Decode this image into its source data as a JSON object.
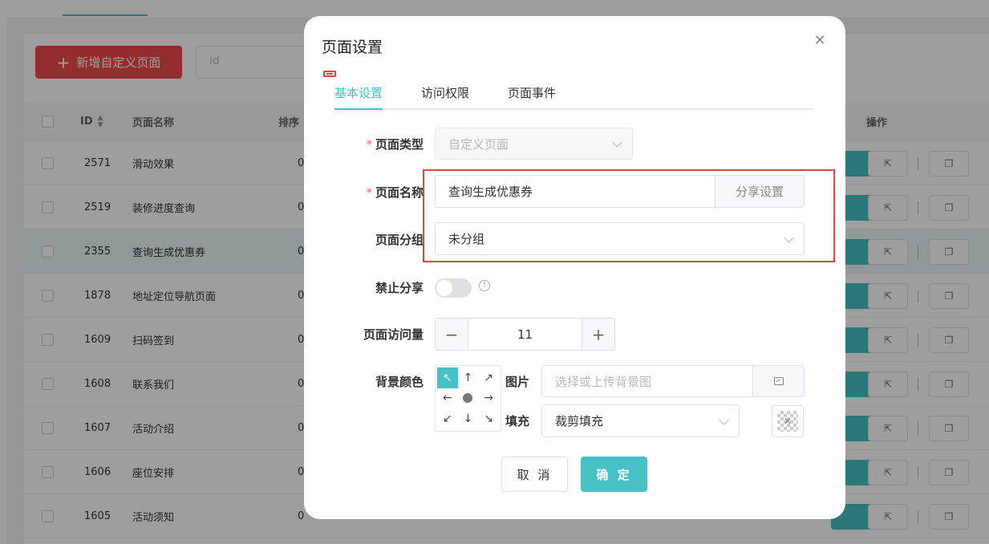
{
  "background": {
    "add_button_label": "新增自定义页面",
    "search_placeholder": "id",
    "table": {
      "headers": {
        "id": "ID",
        "name": "页面名称",
        "sort": "排序",
        "actions": "操作"
      },
      "rows": [
        {
          "id": "2571",
          "name": "滑动效果",
          "sort": "0"
        },
        {
          "id": "2519",
          "name": "装修进度查询",
          "sort": "0"
        },
        {
          "id": "2355",
          "name": "查询生成优惠券",
          "sort": "0"
        },
        {
          "id": "1878",
          "name": "地址定位导航页面",
          "sort": "0"
        },
        {
          "id": "1609",
          "name": "扫码签到",
          "sort": "0"
        },
        {
          "id": "1608",
          "name": "联系我们",
          "sort": "0"
        },
        {
          "id": "1607",
          "name": "活动介绍",
          "sort": "0"
        },
        {
          "id": "1606",
          "name": "座位安排",
          "sort": "0"
        },
        {
          "id": "1605",
          "name": "活动须知",
          "sort": "0"
        }
      ]
    }
  },
  "dialog": {
    "title": "页面设置",
    "tabs": [
      {
        "label": "基本设置",
        "active": true
      },
      {
        "label": "访问权限",
        "active": false
      },
      {
        "label": "页面事件",
        "active": false
      }
    ],
    "fields": {
      "page_type": {
        "label": "页面类型",
        "value": "自定义页面"
      },
      "page_name": {
        "label": "页面名称",
        "value": "查询生成优惠券",
        "append_label": "分享设置"
      },
      "page_group": {
        "label": "页面分组",
        "value": "未分组"
      },
      "disable_share": {
        "label": "禁止分享",
        "enabled": false
      },
      "page_visits": {
        "label": "页面访问量",
        "value": "11"
      },
      "background_color": {
        "label": "背景颜色",
        "image_label": "图片",
        "image_placeholder": "选择或上传背景图",
        "fill_label": "填充",
        "fill_value": "裁剪填充"
      }
    },
    "buttons": {
      "cancel": "取 消",
      "confirm": "确 定"
    }
  },
  "colors": {
    "accent": "#47c1c6",
    "danger": "#ef4a4a",
    "highlight_box": "#e34444"
  }
}
